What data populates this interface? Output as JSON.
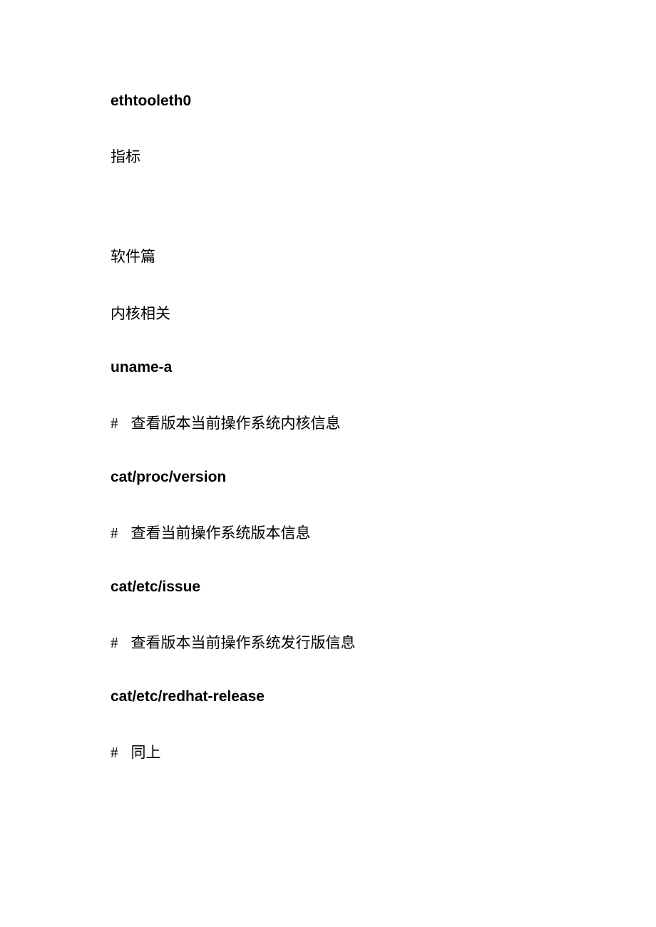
{
  "heading1": "ethtooleth0",
  "para1": "指标",
  "para2": "软件篇",
  "para3": "内核相关",
  "heading2": "uname-a",
  "comment1_hash": "#",
  "comment1_text": "查看版本当前操作系统内核信息",
  "heading3": "cat/proc/version",
  "comment2_hash": "#",
  "comment2_text": "查看当前操作系统版本信息",
  "heading4": "cat/etc/issue",
  "comment3_hash": "#",
  "comment3_text": "查看版本当前操作系统发行版信息",
  "heading5": "cat/etc/redhat-release",
  "comment4_hash": "#",
  "comment4_text": "同上"
}
